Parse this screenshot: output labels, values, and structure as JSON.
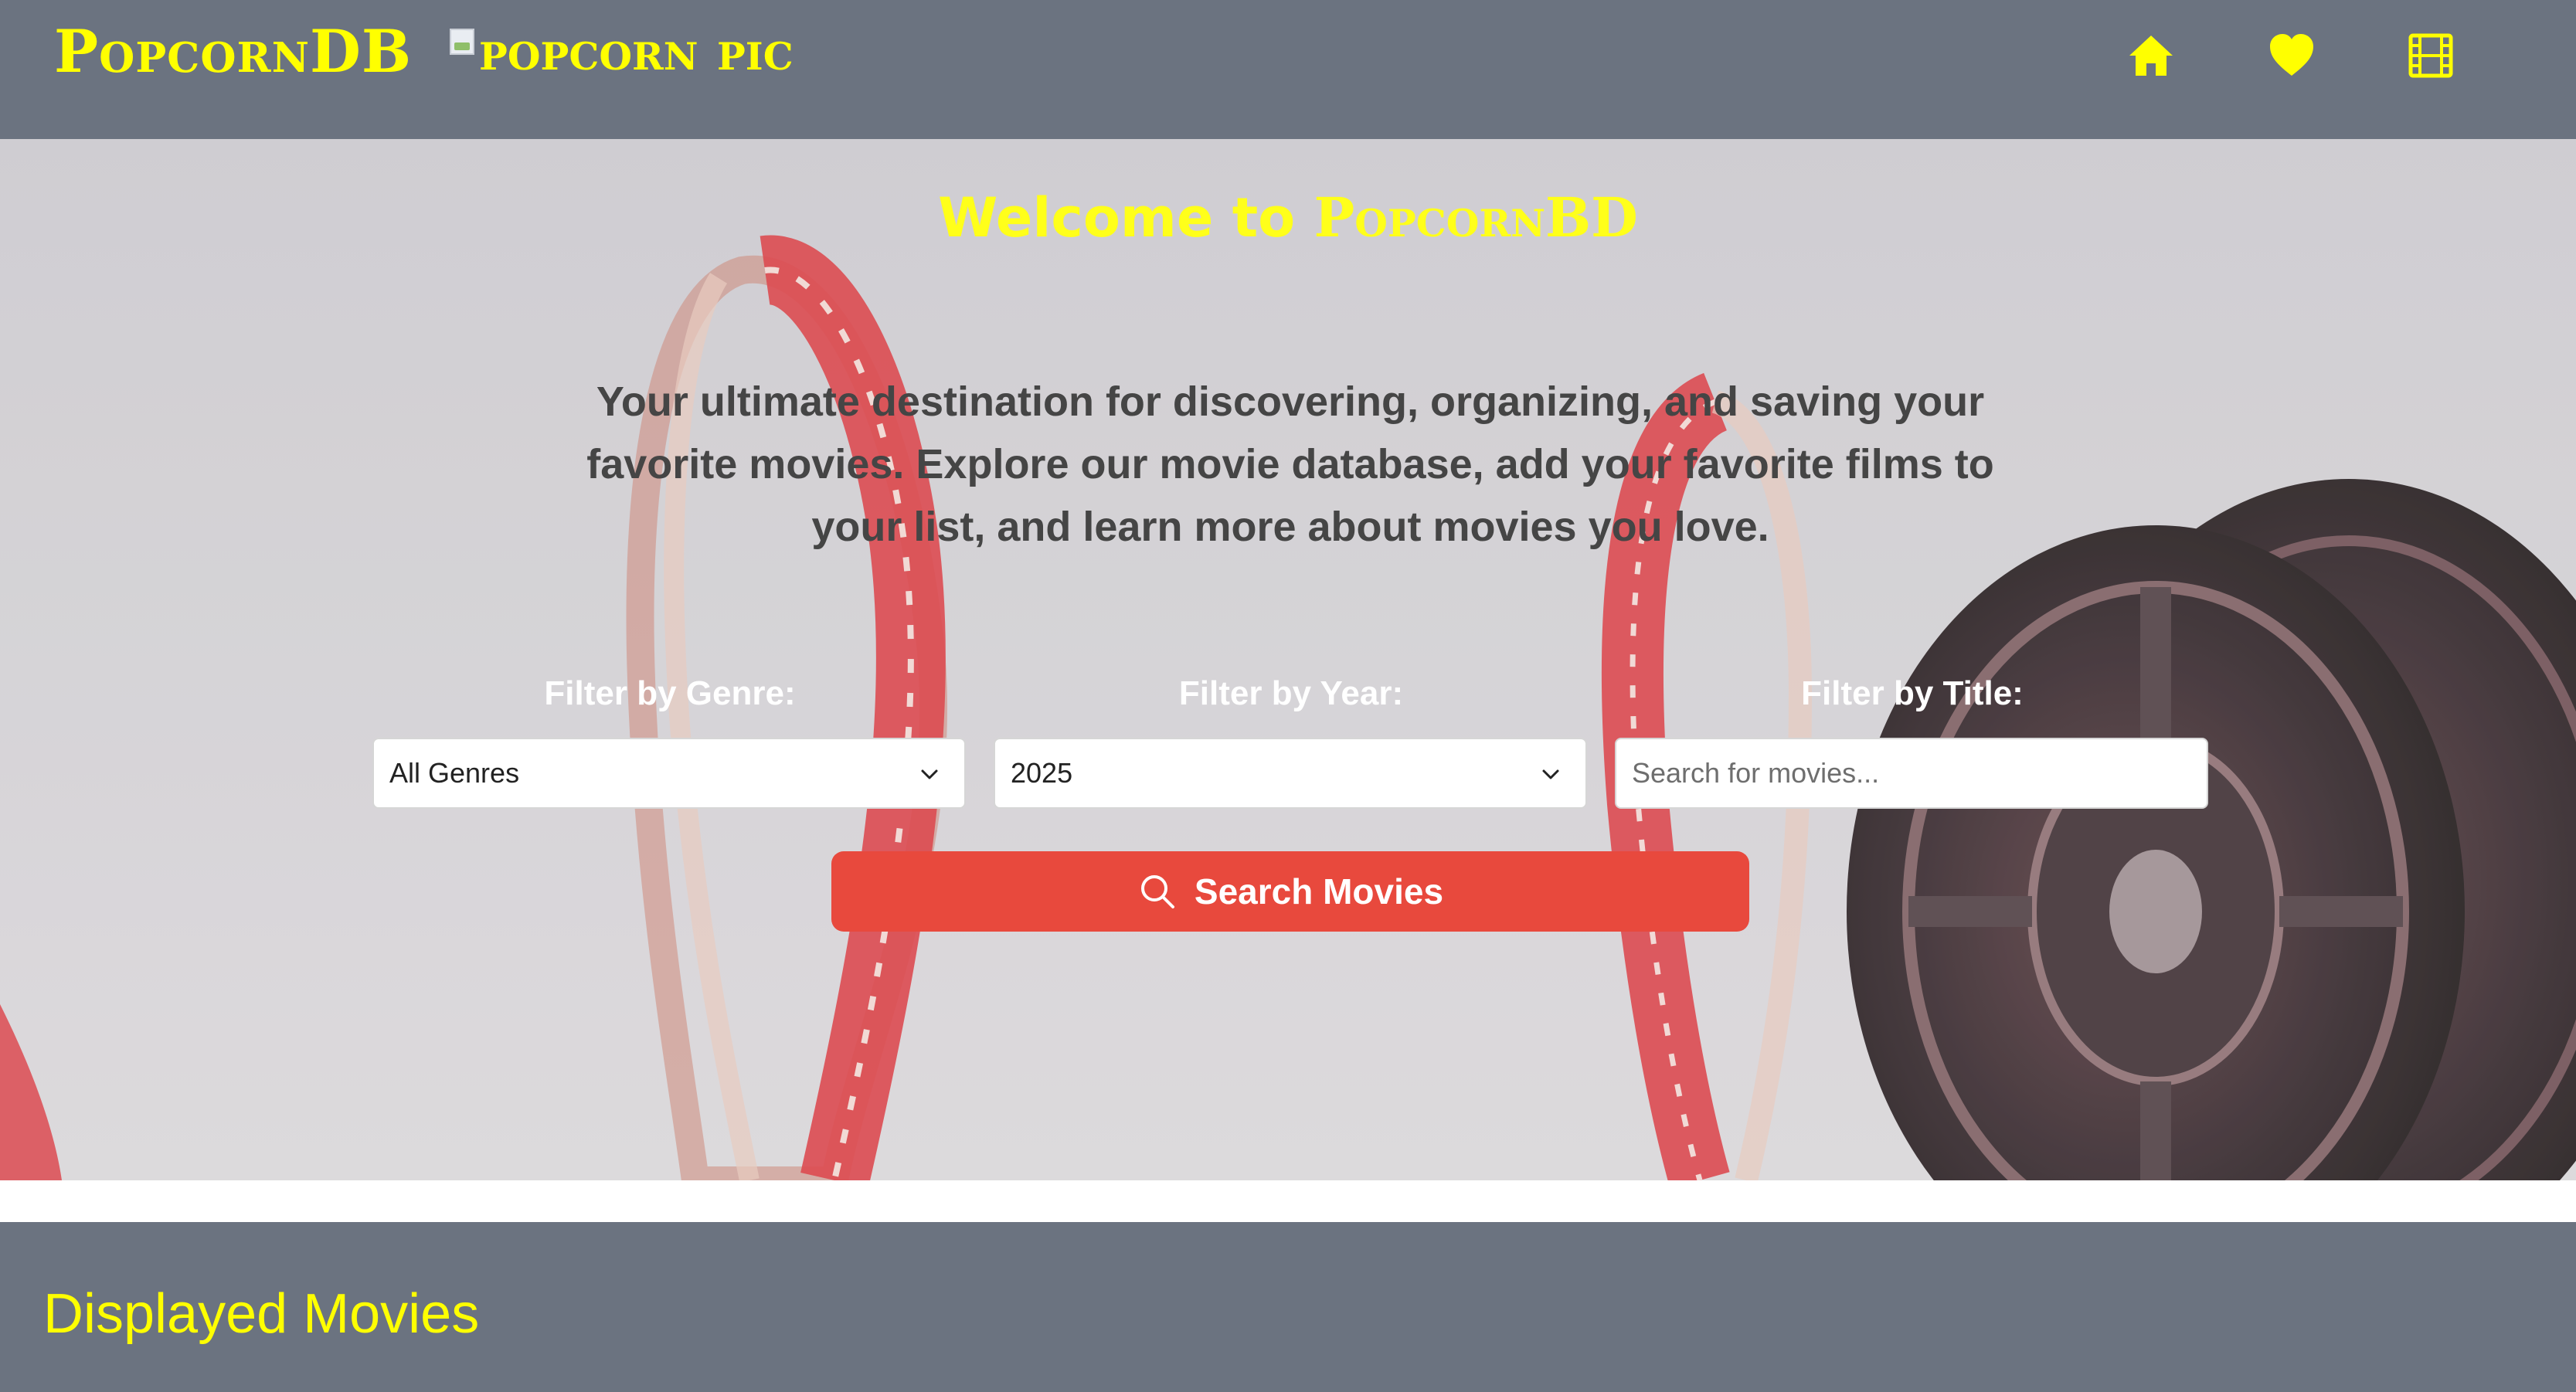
{
  "header": {
    "brand": "PopcornDB",
    "brand_image_alt": "popcorn pic",
    "nav": [
      {
        "icon": "home-icon"
      },
      {
        "icon": "heart-icon"
      },
      {
        "icon": "film-icon"
      }
    ],
    "accent_color": "#ffff00",
    "bar_color": "#6b7380"
  },
  "hero": {
    "title_prefix": "Welcome to",
    "title_brand": "PopcornBD",
    "description": "Your ultimate destination for discovering, organizing, and saving your favorite movies. Explore our movie database, add your favorite films to your list, and learn more about movies you love.",
    "filters": {
      "genre": {
        "label": "Filter by Genre:",
        "value": "All Genres"
      },
      "year": {
        "label": "Filter by Year:",
        "value": "2025"
      },
      "title": {
        "label": "Filter by Title:",
        "placeholder": "Search for movies..."
      }
    },
    "search_button": "Search Movies",
    "button_color": "#e8493d"
  },
  "movies": {
    "title": "Displayed Movies"
  }
}
